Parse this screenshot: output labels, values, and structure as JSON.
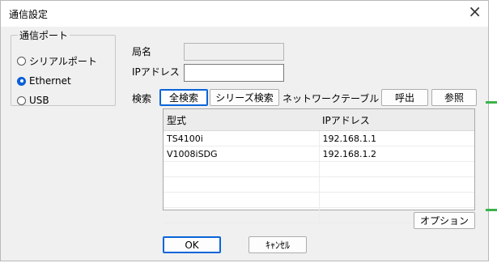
{
  "window": {
    "title": "通信設定",
    "close_glyph": "×"
  },
  "port_group": {
    "legend": "通信ポート",
    "options": [
      {
        "label": "シリアルポート",
        "selected": false
      },
      {
        "label": "Ethernet",
        "selected": true
      },
      {
        "label": "USB",
        "selected": false
      }
    ]
  },
  "form": {
    "station_label": "局名",
    "station_value": "",
    "ip_label": "IPアドレス",
    "ip_value": "",
    "search_label": "検索",
    "search_all_button": "全検索",
    "series_search_button": "シリーズ検索",
    "network_table_label": "ネットワークテーブル",
    "call_button": "呼出",
    "browse_button": "参照"
  },
  "table": {
    "columns": [
      "型式",
      "IPアドレス"
    ],
    "rows": [
      [
        "TS4100i",
        "192.168.1.1"
      ],
      [
        "V1008iSDG",
        "192.168.1.2"
      ],
      [
        "",
        ""
      ],
      [
        "",
        ""
      ],
      [
        "",
        ""
      ],
      [
        "",
        ""
      ]
    ]
  },
  "options_button": "オプション",
  "ok_button": "OK",
  "cancel_button": "ｷｬﾝｾﾙ",
  "colors": {
    "accent": "#0a64d8",
    "side_marker": "#3bb34a"
  }
}
